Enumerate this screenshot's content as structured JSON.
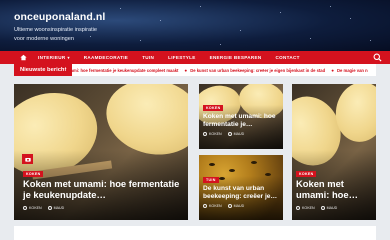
{
  "header": {
    "site_title": "onceuponaland.nl",
    "tagline": "Ultieme woonsinspiratie inspiratie voor moderne woningen"
  },
  "nav": {
    "items": [
      {
        "label": "INTERIEUR",
        "dropdown": true
      },
      {
        "label": "RAAMDECORATIE"
      },
      {
        "label": "TUIN"
      },
      {
        "label": "LIFESTYLE"
      },
      {
        "label": "ENERGIE BESPAREN"
      },
      {
        "label": "CONTACT"
      }
    ]
  },
  "ticker": {
    "label": "Nieuwste bericht",
    "items": [
      "umami: hoe fermentatie je keukenupdate compleet maakt",
      "De kunst van urban beekeeping: creëer je eigen bijenkast in de stad",
      "De magie van n"
    ]
  },
  "cards": {
    "left": {
      "category": "KOKEN",
      "title": "Koken met umami: hoe fermentatie je keukenupdate…",
      "author": "KOKEN",
      "date": "MAUD"
    },
    "mid_top": {
      "category": "KOKEN",
      "title": "Koken met umami: hoe fermentatie je…",
      "author": "KOKEN",
      "date": "MAUD"
    },
    "mid_bottom": {
      "category": "TUIN",
      "title": "De kunst van urban beekeeping: creëer je…",
      "author": "KOKEN",
      "date": "MAUD"
    },
    "right": {
      "category": "KOKEN",
      "title": "Koken met umami: hoe…",
      "author": "KOKEN",
      "date": "MAUD"
    }
  },
  "colors": {
    "accent": "#d4121e",
    "header_bg": "#0e1d3d"
  }
}
